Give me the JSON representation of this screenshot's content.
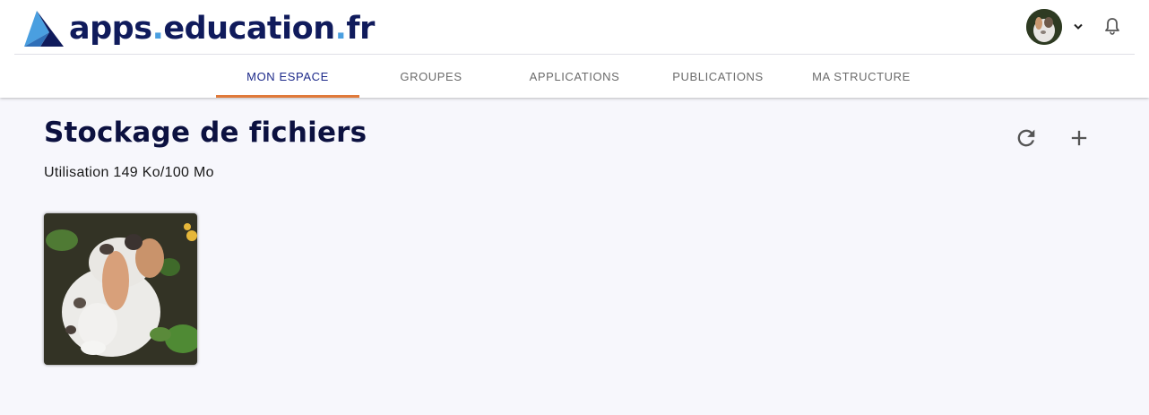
{
  "header": {
    "logo": {
      "text_part1": "apps",
      "dot1": ".",
      "text_part2": "education",
      "dot2": ".",
      "text_part3": "fr"
    },
    "icons": {
      "avatar": "user-avatar",
      "menu": "chevron-down-icon",
      "notifications": "bell-icon"
    }
  },
  "nav": {
    "tabs": [
      {
        "label": "MON ESPACE",
        "active": true
      },
      {
        "label": "GROUPES",
        "active": false
      },
      {
        "label": "APPLICATIONS",
        "active": false
      },
      {
        "label": "PUBLICATIONS",
        "active": false
      },
      {
        "label": "MA STRUCTURE",
        "active": false
      }
    ]
  },
  "main": {
    "title": "Stockage de fichiers",
    "usage": "Utilisation 149 Ko/100 Mo",
    "actions": {
      "refresh": "refresh-icon",
      "add": "plus-icon"
    },
    "files": [
      {
        "type": "image",
        "thumbnail": "rabbit-photo"
      }
    ]
  },
  "colors": {
    "brand_navy": "#101b5c",
    "brand_blue": "#4a9fe0",
    "active_tab_text": "#1d2a8a",
    "active_tab_underline": "#e07a3a",
    "page_background": "#f7f7fc"
  }
}
